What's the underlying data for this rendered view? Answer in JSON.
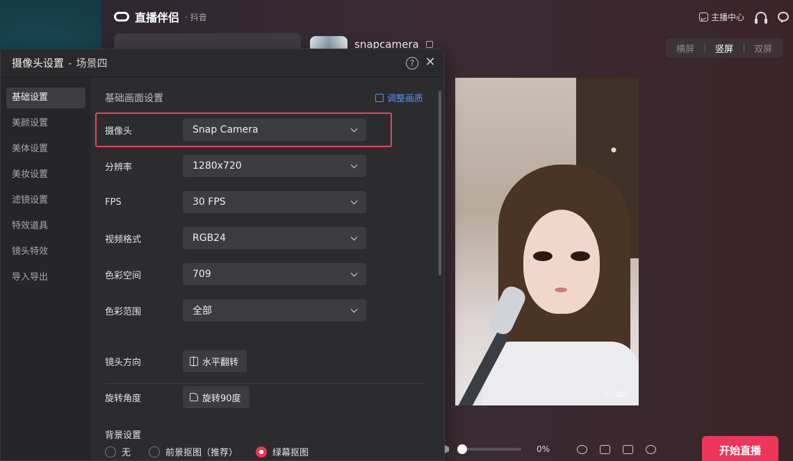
{
  "app": {
    "name": "直播伴侣",
    "platform": "· 抖音"
  },
  "topbar": {
    "anchor_center": "主播中心"
  },
  "profile": {
    "name": "snapcamera"
  },
  "orientation": {
    "options": [
      "横屏",
      "竖屏",
      "双屏"
    ],
    "selected": "竖屏"
  },
  "preview": {
    "watermark": "亿动高阳"
  },
  "controls": {
    "volume": "0%",
    "start_live": "开始直播"
  },
  "dialog": {
    "title": "摄像头设置",
    "separator": "-",
    "scene": "场景四",
    "help": "?",
    "close": "✕",
    "nav": [
      "基础设置",
      "美颜设置",
      "美体设置",
      "美妆设置",
      "滤镜设置",
      "特效道具",
      "镜头特效",
      "导入导出"
    ],
    "nav_active": "基础设置",
    "section_title": "基础画面设置",
    "adjust_link": "调整画质",
    "fields": {
      "camera": {
        "label": "摄像头",
        "value": "Snap Camera"
      },
      "resolution": {
        "label": "分辨率",
        "value": "1280x720"
      },
      "fps": {
        "label": "FPS",
        "value": "30 FPS"
      },
      "video_format": {
        "label": "视频格式",
        "value": "RGB24"
      },
      "color_space": {
        "label": "色彩空间",
        "value": "709"
      },
      "color_range": {
        "label": "色彩范围",
        "value": "全部"
      }
    },
    "lens_direction": {
      "label": "镜头方向",
      "button": "水平翻转"
    },
    "rotation": {
      "label": "旋转角度",
      "button": "旋转90度"
    },
    "background": {
      "label": "背景设置",
      "options": [
        "无",
        "前景抠图（推荐）",
        "绿幕抠图"
      ],
      "selected": "绿幕抠图"
    }
  },
  "colors": {
    "accent": "#f0355a",
    "link": "#5b8ff9",
    "highlight_border": "#e9455d"
  }
}
